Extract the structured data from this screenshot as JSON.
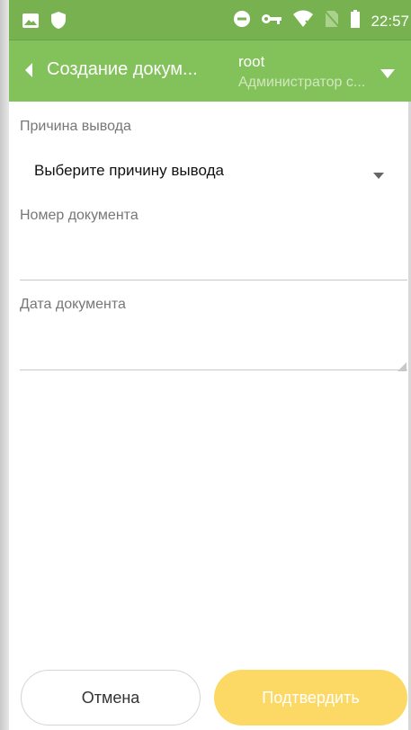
{
  "status_bar": {
    "time": "22:57",
    "left_icons": [
      "image-icon",
      "shield-icon"
    ],
    "right_icons": [
      "do-not-disturb-icon",
      "vpn-key-icon",
      "wifi-off-icon",
      "no-sim-icon",
      "battery-icon"
    ]
  },
  "app_bar": {
    "title": "Создание докум...",
    "user_name": "root",
    "user_role": "Администратор с...",
    "color": "#83c15a"
  },
  "form": {
    "reason_label": "Причина вывода",
    "reason_value": "Выберите причину вывода",
    "doc_number_label": "Номер документа",
    "doc_number_value": "",
    "doc_date_label": "Дата документа",
    "doc_date_value": ""
  },
  "buttons": {
    "cancel": "Отмена",
    "confirm": "Подтвердить",
    "confirm_color": "#fbd964"
  }
}
